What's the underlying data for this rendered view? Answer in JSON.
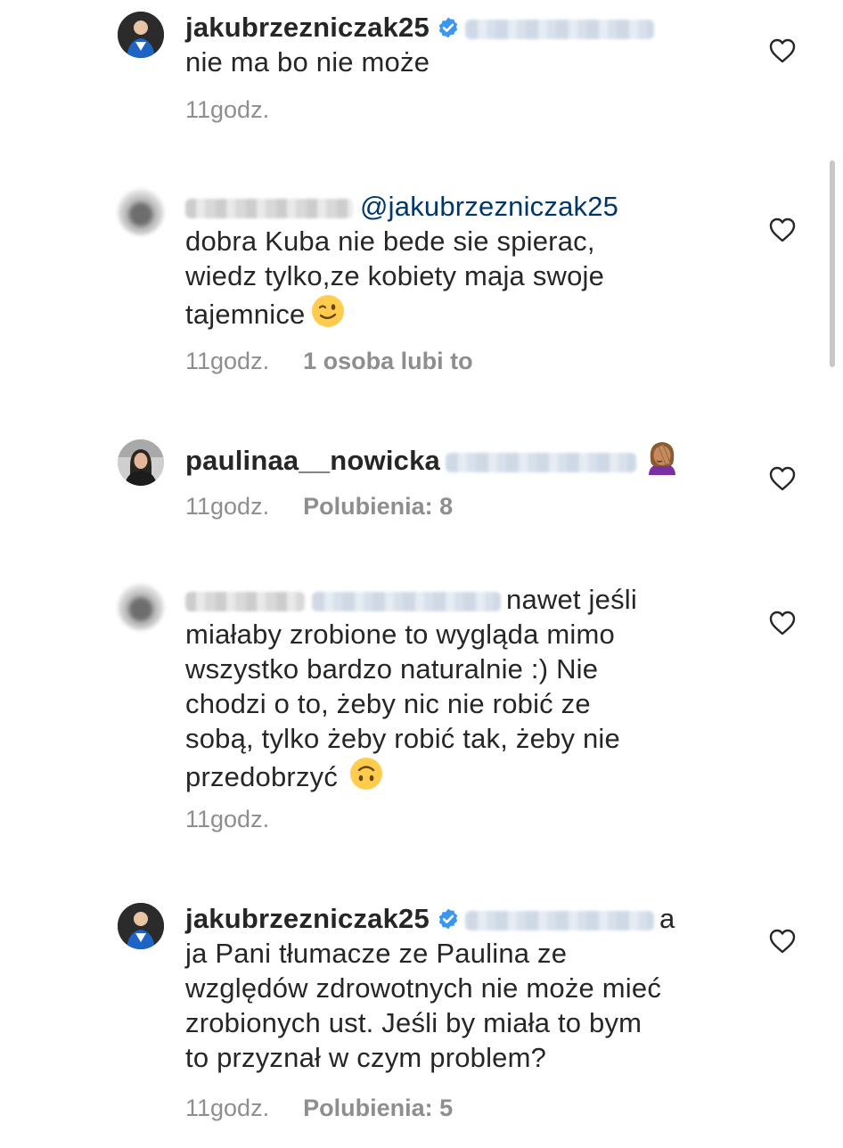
{
  "comments": [
    {
      "username": "jakubrzezniczak25",
      "verified": true,
      "text_lines": [
        "nie ma bo nie może"
      ],
      "time": "11godz.",
      "likes": ""
    },
    {
      "mention": "@jakubrzezniczak25",
      "text_lines": [
        "dobra Kuba nie bede sie spierac,",
        "wiedz tylko,ze kobiety maja swoje",
        "tajemnice"
      ],
      "time": "11godz.",
      "likes": "1 osoba lubi to"
    },
    {
      "username": "paulinaa__nowicka",
      "time": "11godz.",
      "likes": "Polubienia: 8"
    },
    {
      "first_line_text": "nawet jeśli",
      "text_lines": [
        "miałaby zrobione to wygląda mimo",
        "wszystko bardzo naturalnie :) Nie",
        "chodzi o to, żeby nic nie robić ze",
        "sobą, tylko żeby robić tak, żeby nie",
        "przedobrzyć"
      ],
      "time": "11godz.",
      "likes": ""
    },
    {
      "username": "jakubrzezniczak25",
      "verified": true,
      "first_line_tail": "a",
      "text_lines": [
        "ja Pani tłumacze ze Paulina ze",
        "względów zdrowotnych nie może mieć",
        "zrobionych ust. Jeśli by miała to bym",
        "to przyznał w czym problem?"
      ],
      "time": "11godz.",
      "likes": "Polubienia: 5"
    }
  ],
  "icons": {
    "verified": "verified-badge-icon",
    "like": "heart-outline-icon",
    "wink_emoji": "winking-face-emoji",
    "facepalm_emoji": "woman-facepalming-emoji",
    "upside_down_emoji": "upside-down-face-emoji"
  },
  "colors": {
    "text": "#262626",
    "meta": "#8e8e8e",
    "mention": "#00376b",
    "verified": "#3897f0"
  }
}
